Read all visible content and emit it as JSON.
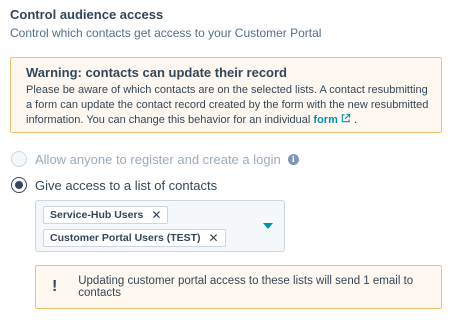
{
  "section": {
    "title": "Control audience access",
    "subtitle": "Control which contacts get access to your Customer Portal"
  },
  "warning": {
    "title": "Warning: contacts can update their record",
    "line1": "Please be aware of which contacts are on the selected lists. A contact resubmitting",
    "line2": "a form can update the contact record created by the form with the new resubmitted",
    "line3_pre": "information. You can change this behavior for an individual",
    "link": "form",
    "line3_post": ".",
    "link_icon": "external-link-icon"
  },
  "options": {
    "register": {
      "label": "Allow anyone to register and create a login",
      "selected": false,
      "disabled": true,
      "info_icon": "info-icon"
    },
    "list_access": {
      "label": "Give access to a list of contacts",
      "selected": true
    }
  },
  "lists": {
    "selected": [
      {
        "label": "Service-Hub Users"
      },
      {
        "label": "Customer Portal Users (TEST)"
      }
    ],
    "remove_glyph": "✕",
    "dropdown_icon": "caret-down-icon"
  },
  "notice": {
    "icon": "!",
    "text": "Updating customer portal access to these lists will send 1 email to contacts"
  },
  "colors": {
    "text": "#33475b",
    "subtext": "#516f90",
    "link": "#0091ae",
    "warning_bg": "#fef8f0",
    "warning_border": "#f5c26b",
    "disabled": "#99acc2"
  }
}
